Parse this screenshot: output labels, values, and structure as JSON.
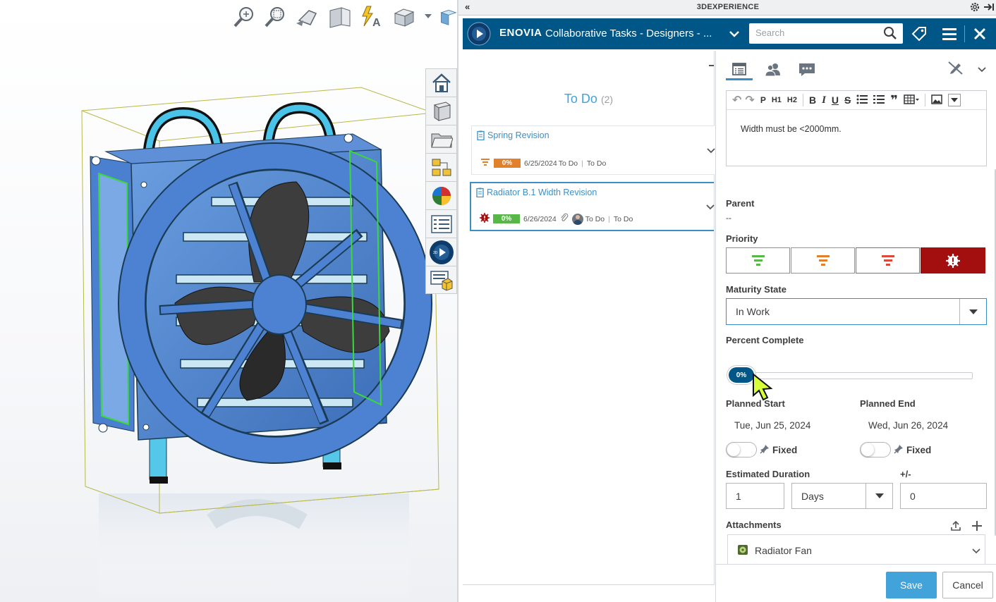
{
  "viewport": {
    "top_tools": [
      "zoom-to-fit-icon",
      "zoom-to-area-icon",
      "previous-view-icon",
      "section-view-icon",
      "dynamic-annotation-icon",
      "view-orientation-icon",
      "display-style-icon"
    ],
    "side_tools": [
      "home-icon",
      "part-icon",
      "folder-icon",
      "view-palette-icon",
      "appearance-icon",
      "custom-properties-icon",
      "3dexperience-compass-icon",
      "design-library-icon"
    ]
  },
  "window": {
    "title": "3DEXPERIENCE"
  },
  "appbar": {
    "brand": "ENOVIA",
    "title": "Collaborative Tasks - Designers - ...",
    "search_placeholder": "Search"
  },
  "list": {
    "group_title": "To Do",
    "group_count": "(2)",
    "tasks": [
      {
        "name": "Spring Revision",
        "percent": "0%",
        "date": "6/25/2024",
        "state1": "To Do",
        "state2": "To Do",
        "priority_icon": "medium-priority-icon"
      },
      {
        "name": "Radiator B.1 Width Revision",
        "percent": "0%",
        "date": "6/26/2024",
        "state1": "To Do",
        "state2": "To Do",
        "priority_icon": "urgent-priority-icon"
      }
    ]
  },
  "detail": {
    "editor_toolbar": [
      "undo-icon",
      "redo-icon",
      "P",
      "H1",
      "H2",
      "B",
      "I",
      "U",
      "S",
      "bullet-list-icon",
      "number-list-icon",
      "quote-icon",
      "table-icon",
      "image-icon",
      "more-icon"
    ],
    "description": "Width must be <2000mm.",
    "parent_label": "Parent",
    "parent_value": "--",
    "priority_label": "Priority",
    "priority_selected": "urgent",
    "maturity_label": "Maturity State",
    "maturity_value": "In Work",
    "percent_label": "Percent Complete",
    "percent_value": "0%",
    "planned_start_label": "Planned Start",
    "planned_start_value": "Tue, Jun 25, 2024",
    "planned_end_label": "Planned End",
    "planned_end_value": "Wed, Jun 26, 2024",
    "fixed_label": "Fixed",
    "est_duration_label": "Estimated Duration",
    "est_duration_value": "1",
    "duration_unit": "Days",
    "plusminus_label": "+/-",
    "plusminus_value": "0",
    "attachments_label": "Attachments",
    "attachment_name": "Radiator Fan",
    "save_label": "Save",
    "cancel_label": "Cancel"
  },
  "colors": {
    "appbar": "#005686",
    "accent": "#368ec4",
    "progress_orange": "#e1812d",
    "progress_green": "#57b847",
    "urgent": "#a30e0e",
    "save": "#42a2da"
  }
}
